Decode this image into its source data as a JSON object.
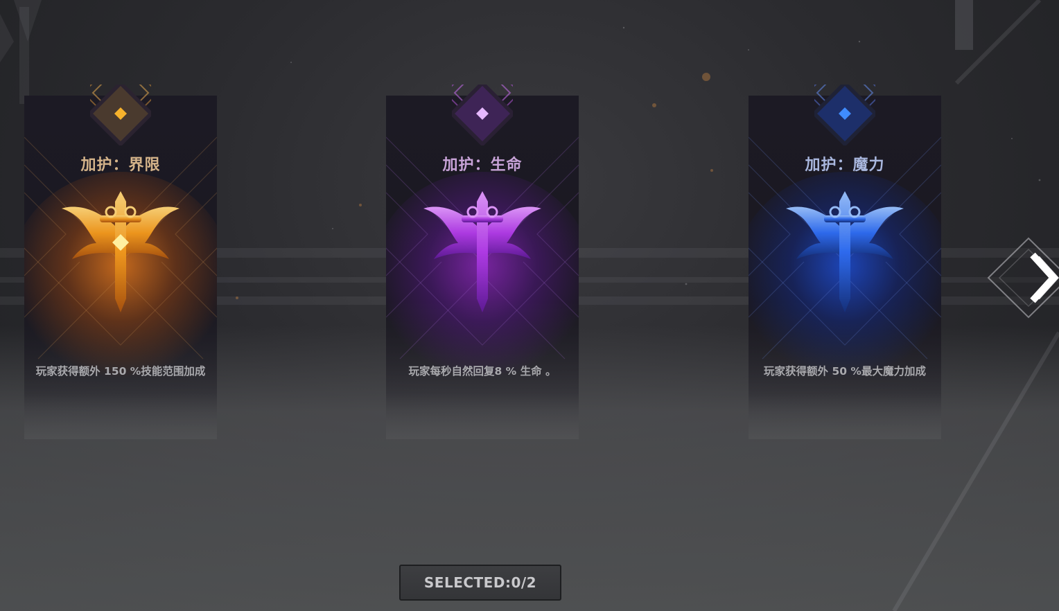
{
  "cards": [
    {
      "title": "加护：界限",
      "description": "玩家获得额外 150 %技能范围加成",
      "icon": "golden-winged-sword-icon",
      "accent": "#f2a425",
      "title_color": "#d5b48a"
    },
    {
      "title": "加护：生命",
      "description": "玩家每秒自然回复8 % 生命 。",
      "icon": "purple-winged-sword-icon",
      "accent": "#b24cf0",
      "title_color": "#c8a3d8"
    },
    {
      "title": "加护：魔力",
      "description": "玩家获得额外 50 %最大魔力加成",
      "icon": "blue-winged-sword-icon",
      "accent": "#2f6df2",
      "title_color": "#a9b7de"
    }
  ],
  "next_button": {
    "icon": "chevron-right-icon"
  },
  "status": {
    "selected_text": "SELECTED:0/2"
  }
}
